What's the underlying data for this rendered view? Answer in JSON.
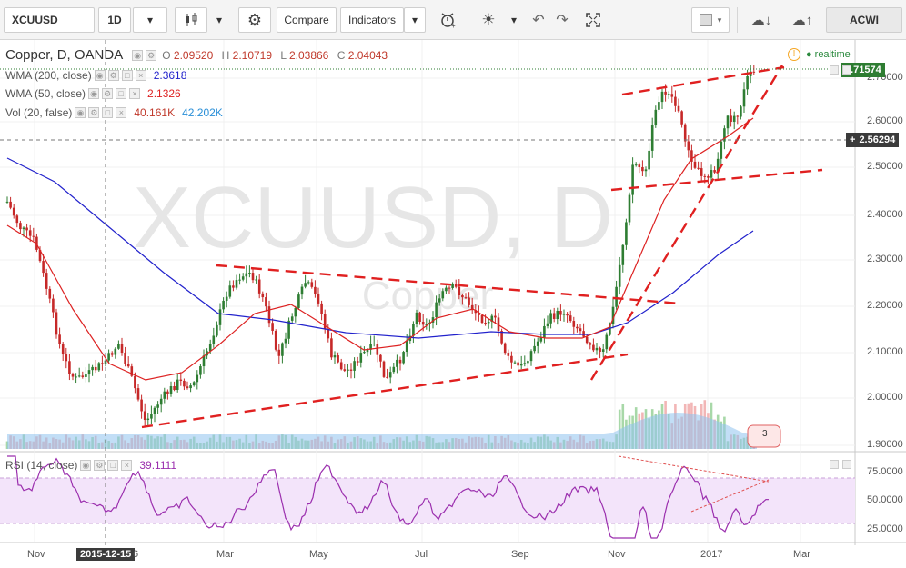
{
  "toolbar": {
    "symbol": "XCUUSD",
    "interval": "1D",
    "compare_label": "Compare",
    "indicators_label": "Indicators",
    "layout_label": "ACWI"
  },
  "legend": {
    "title": "Copper, D, OANDA",
    "open_label": "O",
    "open": "2.09520",
    "high_label": "H",
    "high": "2.10719",
    "low_label": "L",
    "low": "2.03866",
    "close_label": "C",
    "close": "2.04043",
    "wma200_label": "WMA (200, close)",
    "wma200_value": "2.3618",
    "wma200_color": "#2222cc",
    "wma50_label": "WMA (50, close)",
    "wma50_value": "2.1326",
    "wma50_color": "#dd2222",
    "vol_label": "Vol (20, false)",
    "vol_value1": "40.161K",
    "vol_value2": "42.202K",
    "rsi_label": "RSI (14, close)",
    "rsi_value": "39.1111",
    "realtime": "realtime"
  },
  "watermark": {
    "symbol": "XCUUSD, D",
    "name": "Copper"
  },
  "price_axis": {
    "ticks": [
      "2.70000",
      "2.60000",
      "2.50000",
      "2.40000",
      "2.30000",
      "2.20000",
      "2.10000",
      "2.00000",
      "1.90000"
    ],
    "last_price": "2.71574",
    "crosshair_price": "2.56294"
  },
  "rsi_axis": {
    "ticks": [
      "75.0000",
      "50.0000",
      "25.0000"
    ]
  },
  "time_axis": {
    "ticks": [
      "Nov",
      "Mar",
      "May",
      "Jul",
      "Sep",
      "Nov",
      "2017",
      "Mar"
    ],
    "crosshair_date": "2015-12-15",
    "partial_label": "6"
  },
  "volume_badge": "3",
  "colors": {
    "up_candle": "#2e7d32",
    "down_candle": "#c62828",
    "trendline": "#e02020",
    "rsi_line": "#9b2fae",
    "rsi_band": "#f3e4fa",
    "volume_up": "#a8d8a8",
    "volume_down": "#f2b6b6",
    "volume_ma": "#8fc3ee"
  }
}
